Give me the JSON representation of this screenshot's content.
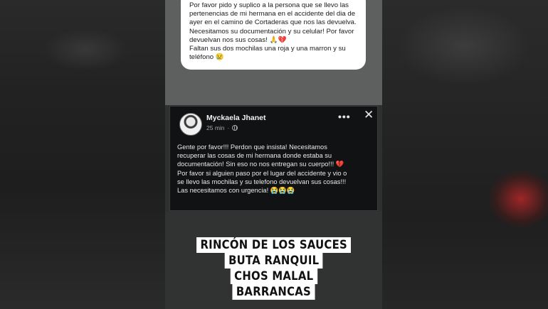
{
  "top_bubble": {
    "lines": [
      "Por favor pido y suplico a la persona que se llevo las",
      "pertenencias de mi hermana en el accidente del dia de",
      "ayer en el camino de Cortaderas que nos las devuelva.",
      "Necesitamos su documentación y su celular! Por favor",
      "devuelvan nos sus cosas! 🙏💔",
      "Faltan sus dos mochilas una roja y una marron y su",
      "teléfono 😢"
    ]
  },
  "post": {
    "author": "Myckaela Jhanet",
    "time": "25 min",
    "separator": "·",
    "more_label": "•••",
    "close_label": "✕",
    "lines": [
      "Gente por favor!!! Perdon que insista! Necesitamos",
      "recuperar las cosas de mi hermana donde estaba su",
      "documentación! Sin eso no nos entregan su cuerpo!!! 💔",
      "Por favor si alguien paso por el lugar del accidente y vio o",
      "se llevo las mochilas y su telefono devuelvan sus cosas!!!",
      "Las necesitamos con urgencia! 😭😭😭"
    ]
  },
  "locations": [
    "RINCÓN DE LOS SAUCES",
    "BUTA RANQUIL",
    "CHOS MALAL",
    "BARRANCAS"
  ],
  "colors": {
    "post_background": "#111213",
    "bubble_background": "#ffffff",
    "accent_red_blur": "#c82828"
  }
}
